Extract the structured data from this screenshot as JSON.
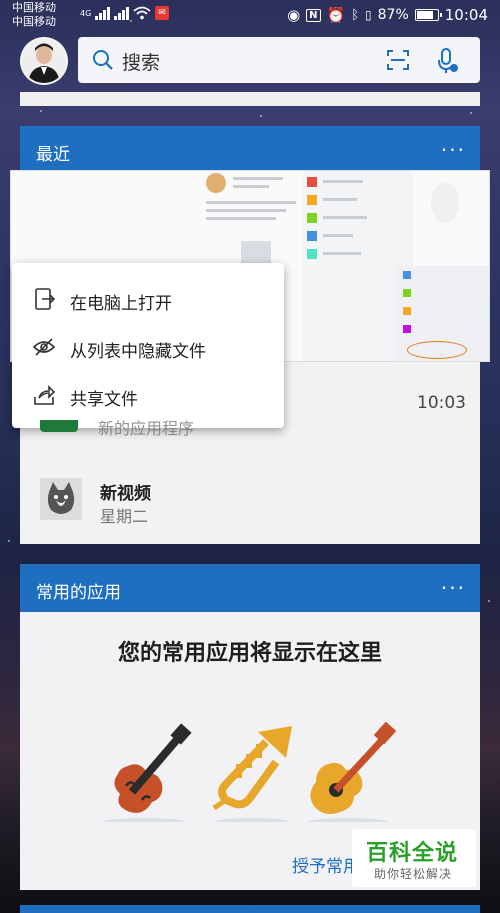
{
  "status_bar": {
    "carrier1": "中国移动",
    "carrier2": "中国移动",
    "net_type": "4G",
    "battery": "87%",
    "battery_level": 0.87,
    "time": "10:04"
  },
  "search": {
    "placeholder": "搜索"
  },
  "recent": {
    "title": "最近",
    "more": "···",
    "context_menu": [
      {
        "label": "在电脑上打开",
        "icon": "open-on-pc-icon"
      },
      {
        "label": "从列表中隐藏文件",
        "icon": "hide-icon"
      },
      {
        "label": "共享文件",
        "icon": "share-icon"
      }
    ],
    "items": [
      {
        "title": "新的应用程序",
        "time": "10:03"
      },
      {
        "title": "新视频",
        "subtitle": "星期二"
      }
    ]
  },
  "frequent_apps": {
    "title": "常用的应用",
    "more": "···",
    "message": "您的常用应用将显示在这里",
    "grant_label": "授予常用"
  },
  "watermark": {
    "main": "百科全说",
    "sub": "助你轻松解决"
  },
  "colors": {
    "accent": "#1e6fc0",
    "watermark_green": "#2aa02a"
  }
}
